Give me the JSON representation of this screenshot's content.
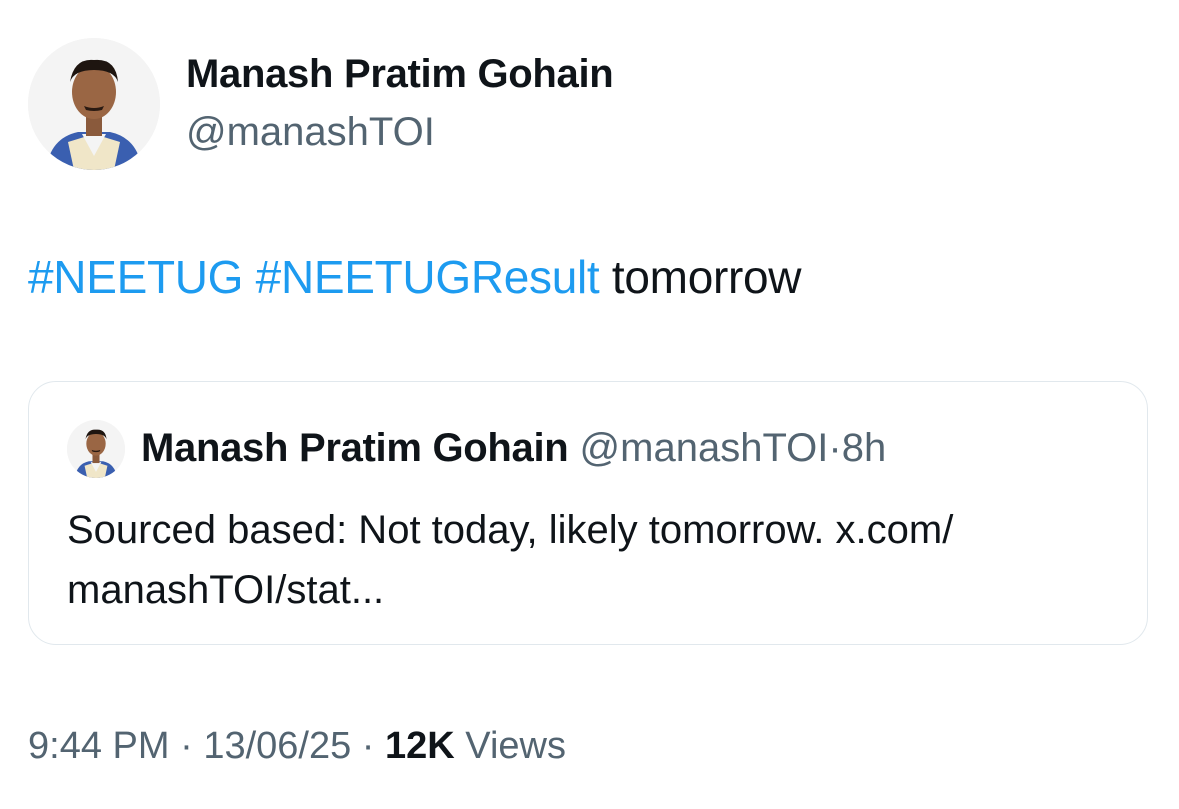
{
  "author": {
    "name": "Manash Pratim Gohain",
    "handle": "@manashTOI",
    "avatar_icon": "profile-photo"
  },
  "tweet": {
    "hashtags": [
      "#NEETUG",
      "#NEETUGResult"
    ],
    "text": "tomorrow"
  },
  "quoted_tweet": {
    "name": "Manash Pratim Gohain",
    "handle": "@manashTOI",
    "time": "8h",
    "separator": "·",
    "body": "Sourced based: Not today, likely tomorrow. x.com/ manashTOI/stat..."
  },
  "footer": {
    "time": "9:44 PM",
    "date": "13/06/25",
    "views_count": "12K",
    "views_label": "Views",
    "separator": "·"
  },
  "colors": {
    "link": "#1d9bf0",
    "secondary_text": "#536471",
    "primary_text": "#0f1419",
    "border": "#e1e8ed"
  }
}
